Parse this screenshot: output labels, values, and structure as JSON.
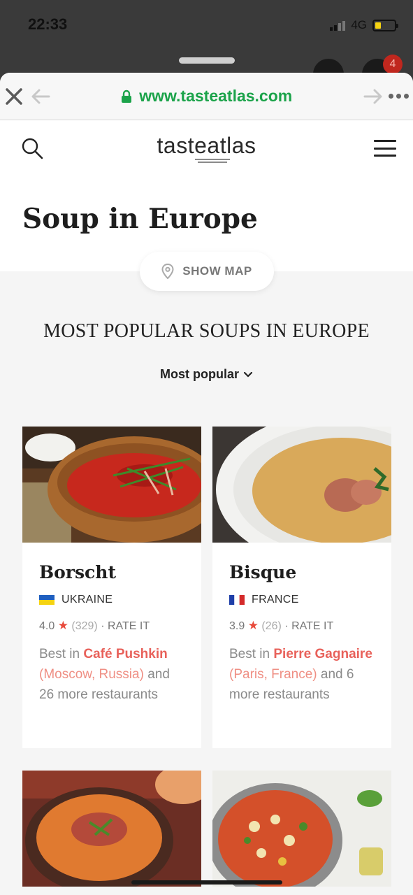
{
  "status_bar": {
    "time": "22:33",
    "network": "4G"
  },
  "behind": {
    "badge_count": "4"
  },
  "browser": {
    "url": "www.tasteatlas.com"
  },
  "site": {
    "logo_text": "tasteatlas"
  },
  "page": {
    "title": "Soup in Europe",
    "show_map_label": "SHOW MAP",
    "section_heading": "MOST POPULAR SOUPS IN EUROPE",
    "sort_label": "Most popular"
  },
  "cards": [
    {
      "name": "Borscht",
      "country": "UKRAINE",
      "rating": "4.0",
      "count": "(329)",
      "rate_label": "· RATE IT",
      "best_prefix": "Best in ",
      "place": "Café Pushkin",
      "place_loc": "(Moscow, Russia)",
      "best_suffix": " and 26 more restaurants"
    },
    {
      "name": "Bisque",
      "country": "FRANCE",
      "rating": "3.9",
      "count": "(26)",
      "rate_label": "· RATE IT",
      "best_prefix": "Best in ",
      "place": "Pierre Gagnaire",
      "place_loc": "(Paris, France)",
      "best_suffix": " and 6 more restaurants"
    }
  ],
  "colors": {
    "url_green": "#1ba34a",
    "accent_red": "#e8615a",
    "star_red": "#e84b3c"
  }
}
